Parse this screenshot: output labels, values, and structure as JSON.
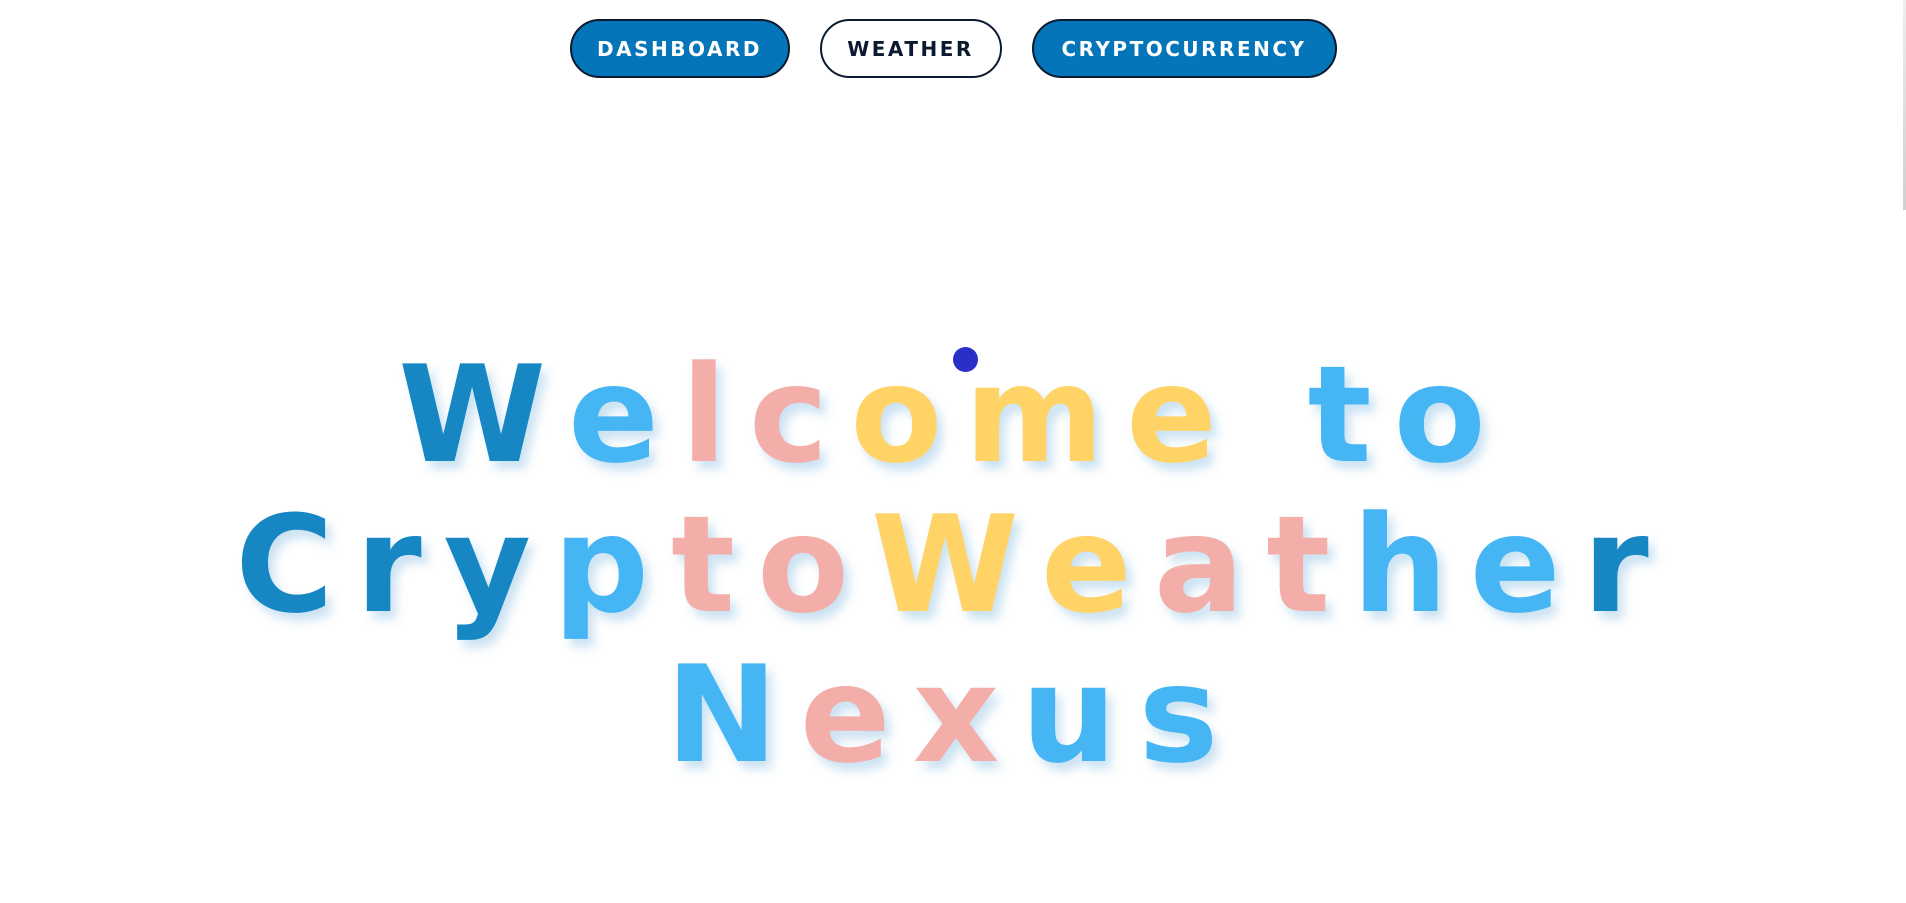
{
  "nav": {
    "dashboard_label": "DASHBOARD",
    "weather_label": "WEATHER",
    "crypto_label": "CRYPTOCURRENCY"
  },
  "hero": {
    "line1": "Welcome to",
    "line2": "CryptoWeather",
    "line3": "Nexus"
  },
  "colors": {
    "nav_filled": "#0375b8",
    "dark_blue": "#1687c2",
    "light_blue": "#45b6f3",
    "pink": "#f4aeaa",
    "yellow": "#ffd366",
    "cursor": "#2a2fc7"
  }
}
